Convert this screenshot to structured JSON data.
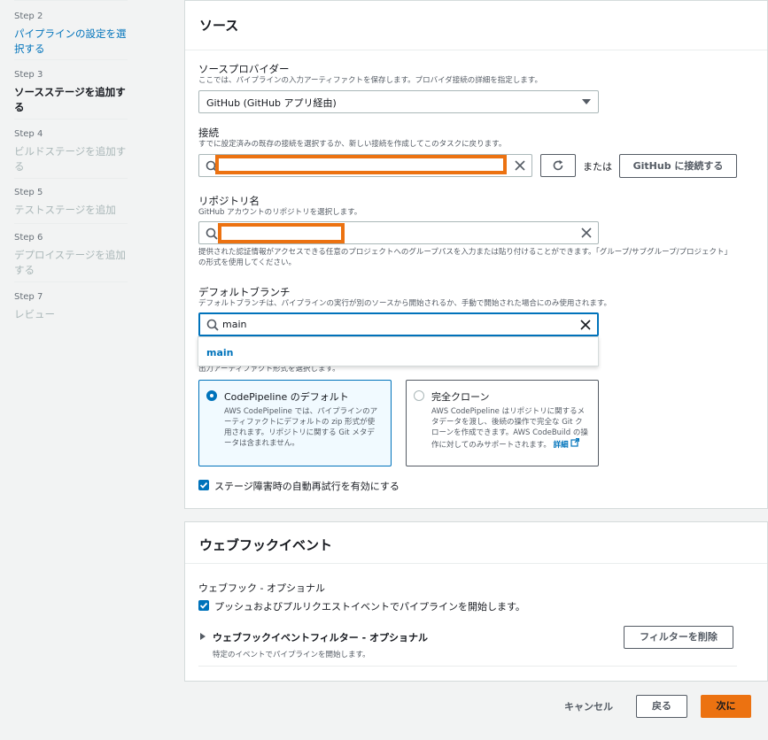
{
  "steps": [
    {
      "num": "Step 2",
      "label": "パイプラインの設定を選\n択する"
    },
    {
      "num": "Step 3",
      "label": "ソースステージを追加す\nる"
    },
    {
      "num": "Step 4",
      "label": "ビルドステージを追加す\nる"
    },
    {
      "num": "Step 5",
      "label": "テストステージを追加"
    },
    {
      "num": "Step 6",
      "label": "デプロイステージを追加\nする"
    },
    {
      "num": "Step 7",
      "label": "レビュー"
    }
  ],
  "source": {
    "title": "ソース",
    "provider_label": "ソースプロバイダー",
    "provider_desc": "ここでは、パイプラインの入力アーティファクトを保存します。プロバイダ接続の詳細を指定します。",
    "provider_value": "GitHub (GitHub アプリ経由)",
    "connection_label": "接続",
    "connection_desc": "すでに設定済みの既存の接続を選択するか、新しい接続を作成してこのタスクに戻ります。",
    "or_text": "または",
    "connect_button": "GitHub に接続する",
    "repo_label": "リポジトリ名",
    "repo_desc": "GitHub アカウントのリポジトリを選択します。",
    "repo_help": "提供された認証情報がアクセスできる任意のプロジェクトへのグループパスを入力または貼り付けることができます。「グループ/サブグループ/プロジェクト」の形式を使用してください。",
    "branch_label": "デフォルトブランチ",
    "branch_desc": "デフォルトブランチは、パイプラインの実行が別のソースから開始されるか、手動で開始された場合にのみ使用されます。",
    "branch_value": "main",
    "branch_option": "main",
    "artifact_desc": "出力アーティファクト形式を選択します。",
    "option_default_title": "CodePipeline のデフォルト",
    "option_default_desc": "AWS CodePipeline では、パイプラインのアーティファクトにデフォルトの zip 形式が使用されます。リポジトリに関する Git メタデータは含まれません。",
    "option_clone_title": "完全クローン",
    "option_clone_desc": "AWS CodePipeline はリポジトリに関するメタデータを渡し、後続の操作で完全な Git クローンを作成できます。AWS CodeBuild の操作に対してのみサポートされます。",
    "option_clone_link": "詳細",
    "retry_label": "ステージ障害時の自動再試行を有効にする"
  },
  "webhook": {
    "title": "ウェブフックイベント",
    "label": "ウェブフック - オプショナル",
    "checkbox_label": "プッシュおよびプルリクエストイベントでパイプラインを開始します。",
    "filter_title": "ウェブフックイベントフィルター - オプショナル",
    "filter_desc": "特定のイベントでパイプラインを開始します。",
    "remove_button": "フィルターを削除"
  },
  "footer": {
    "cancel": "キャンセル",
    "back": "戻る",
    "next": "次に"
  },
  "colors": {
    "accent": "#0073bb",
    "primary": "#ec7211",
    "redaction": "#ec7211"
  }
}
